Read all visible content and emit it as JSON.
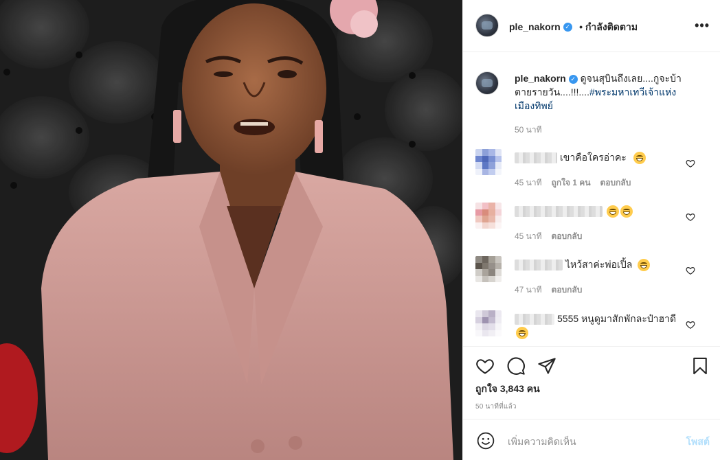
{
  "post": {
    "username": "ple_nakorn",
    "follow_label": "• กำลังติดตาม",
    "more_label": "•••"
  },
  "caption": {
    "username": "ple_nakorn",
    "text": "ดูจนสุบินถึงเลย....กูจะบ้าตายรายวัน....!!!....",
    "hashtag": "#พระมหาเทวีเจ้าแห่งเมืองทิพย์",
    "time": "50 นาที"
  },
  "comments": [
    {
      "text": "เขาคือใครอ่าคะ",
      "emoji_count": 1,
      "time": "45 นาที",
      "likes": "ถูกใจ 1 คน",
      "reply": "ตอบกลับ",
      "avatar_colors": [
        "#c9d3ef",
        "#8da0d8",
        "#a9b7e6",
        "#dfe4f5",
        "#6e86cf",
        "#4f68b8",
        "#7a90d3",
        "#b7c3ec",
        "#d3dbf3",
        "#5e78c4",
        "#8ea1da",
        "#e6eaf7",
        "#eef1fa",
        "#a8b5e3",
        "#c2cdef",
        "#f3f5fb"
      ]
    },
    {
      "text": "",
      "emoji_count": 2,
      "time": "45 นาที",
      "likes": "",
      "reply": "ตอบกลับ",
      "avatar_colors": [
        "#f6e2e4",
        "#f2c0c6",
        "#eab3a8",
        "#f7e6e8",
        "#e79aa4",
        "#d98c7c",
        "#e7b0a0",
        "#f4d4d8",
        "#f0c8c0",
        "#dfa591",
        "#e9b9ac",
        "#f8ecec",
        "#fbf1f1",
        "#f2d6cf",
        "#f6e0db",
        "#fcf5f5"
      ]
    },
    {
      "text": "ไหว้สาค่ะพ่อเปิ้ล",
      "emoji_count": 1,
      "time": "47 นาที",
      "likes": "",
      "reply": "ตอบกลับ",
      "avatar_colors": [
        "#8f8a83",
        "#6d665e",
        "#a49f96",
        "#c8c4be",
        "#5b544c",
        "#7e776e",
        "#96908a",
        "#b6b1aa",
        "#cfccc7",
        "#a9a39b",
        "#8b857e",
        "#dedbd7",
        "#e8e6e3",
        "#c5c1bb",
        "#d7d4cf",
        "#f0eeec"
      ]
    },
    {
      "text": "5555 หนูดูมาสักพักละป๋าฮาดี",
      "emoji_count": 1,
      "time": "",
      "likes": "",
      "reply": "",
      "avatar_colors": [
        "#e9e6ee",
        "#cfc9d8",
        "#b9b0c6",
        "#ece9f1",
        "#d6d0df",
        "#9e93b0",
        "#c4bcd0",
        "#eeecf2",
        "#f2f0f5",
        "#ddd8e5",
        "#e3dfea",
        "#f6f5f8",
        "#f8f7fa",
        "#eae7ef",
        "#f1eff4",
        "#fbfafc"
      ]
    }
  ],
  "actions": {
    "likes_label": "ถูกใจ 3,843 คน",
    "post_time": "50 นาทีที่แล้ว"
  },
  "add_comment": {
    "placeholder": "เพิ่มความคิดเห็น",
    "post_label": "โพสต์"
  },
  "colors": {
    "accent": "#3897f0",
    "hashtag": "#00376b",
    "secondary_text": "#8e8e8e",
    "post_button_disabled": "#b2dffc"
  },
  "icons": {
    "header_avatar": "profile-avatar",
    "verified": "verified-badge-icon",
    "like": "heart-outline-icon",
    "comment": "speech-bubble-icon",
    "share": "paper-plane-icon",
    "save": "bookmark-icon",
    "emoji": "smiley-icon"
  }
}
